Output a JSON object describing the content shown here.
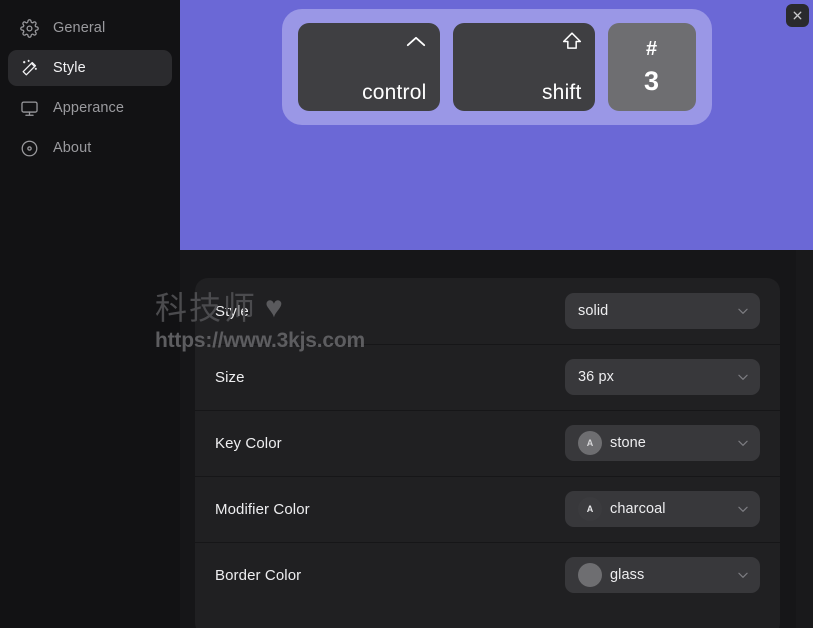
{
  "sidebar": {
    "items": [
      {
        "label": "General",
        "icon": "gear-icon",
        "active": false
      },
      {
        "label": "Style",
        "icon": "magic-wand-icon",
        "active": true
      },
      {
        "label": "Apperance",
        "icon": "monitor-icon",
        "active": false
      },
      {
        "label": "About",
        "icon": "info-circle-icon",
        "active": false
      }
    ]
  },
  "preview": {
    "background_color": "#6b68d6",
    "tray_color": "#9a97e6",
    "close_button": {
      "icon": "close-icon",
      "label": "Close"
    },
    "keys": [
      {
        "type": "modifier",
        "glyph": "control-caret-icon",
        "label": "control",
        "color": "#3f3f42"
      },
      {
        "type": "modifier",
        "glyph": "shift-arrow-icon",
        "label": "shift",
        "color": "#3f3f42"
      },
      {
        "type": "letter",
        "top": "#",
        "bottom": "3",
        "color": "#6e6e71"
      }
    ]
  },
  "settings": {
    "rows": [
      {
        "label": "Style",
        "value": "solid",
        "swatch": null
      },
      {
        "label": "Size",
        "value": "36 px",
        "swatch": null
      },
      {
        "label": "Key Color",
        "value": "stone",
        "swatch": {
          "color": "#6e6e71",
          "letter": "A",
          "letter_color": "#d8d8da"
        }
      },
      {
        "label": "Modifier Color",
        "value": "charcoal",
        "swatch": {
          "color": "#3b3b3e",
          "letter": "A",
          "letter_color": "#e8e8ea"
        }
      },
      {
        "label": "Border Color",
        "value": "glass",
        "swatch": {
          "color": "#6e6e71",
          "letter": "",
          "letter_color": "#d8d8da"
        }
      }
    ],
    "chevron_icon": "chevron-down-icon"
  },
  "watermark": {
    "text": "科技师",
    "heart": "♥",
    "url": "https://www.3kjs.com"
  }
}
